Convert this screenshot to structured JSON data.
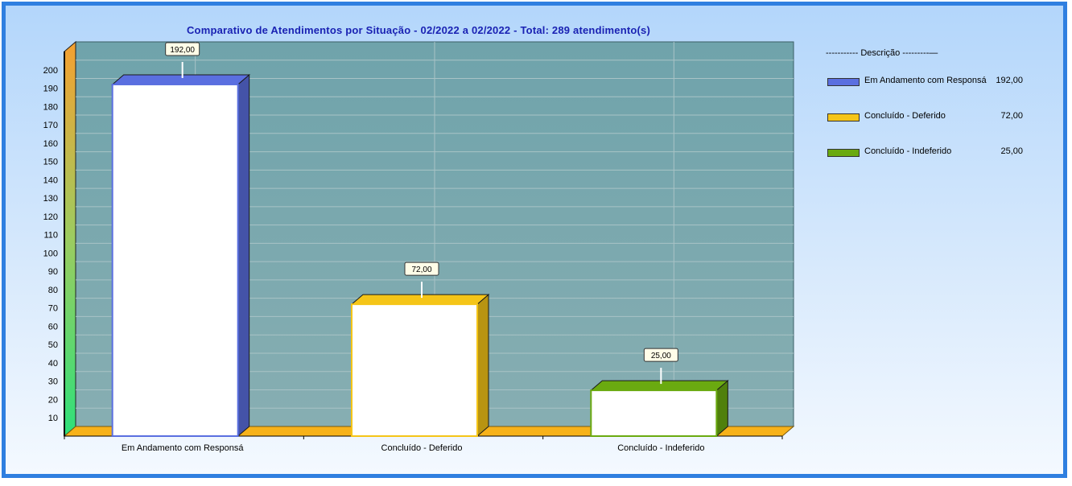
{
  "chart_data": {
    "type": "bar",
    "title": "Comparativo de Atendimentos por Situação - 02/2022 a 02/2022 - Total: 289 atendimento(s)",
    "categories": [
      "Em Andamento com Responsá",
      "Concluído - Deferido",
      "Concluído - Indeferido"
    ],
    "values": [
      192,
      72,
      25
    ],
    "value_labels": [
      "192,00",
      "72,00",
      "25,00"
    ],
    "colors": [
      "#5a6fe0",
      "#f5c518",
      "#6aaa10"
    ],
    "y_ticks": [
      10,
      20,
      30,
      40,
      50,
      60,
      70,
      80,
      90,
      100,
      110,
      120,
      130,
      140,
      150,
      160,
      170,
      180,
      190,
      200
    ],
    "ylim": [
      0,
      210
    ],
    "grid": true,
    "legend_position": "right",
    "legend": {
      "header": "----------- Descrição ---------—",
      "items": [
        {
          "label": "Em Andamento com Responsá",
          "value": "192,00"
        },
        {
          "label": "Concluído - Deferido",
          "value": "72,00"
        },
        {
          "label": "Concluído - Indeferido",
          "value": "25,00"
        }
      ]
    }
  }
}
